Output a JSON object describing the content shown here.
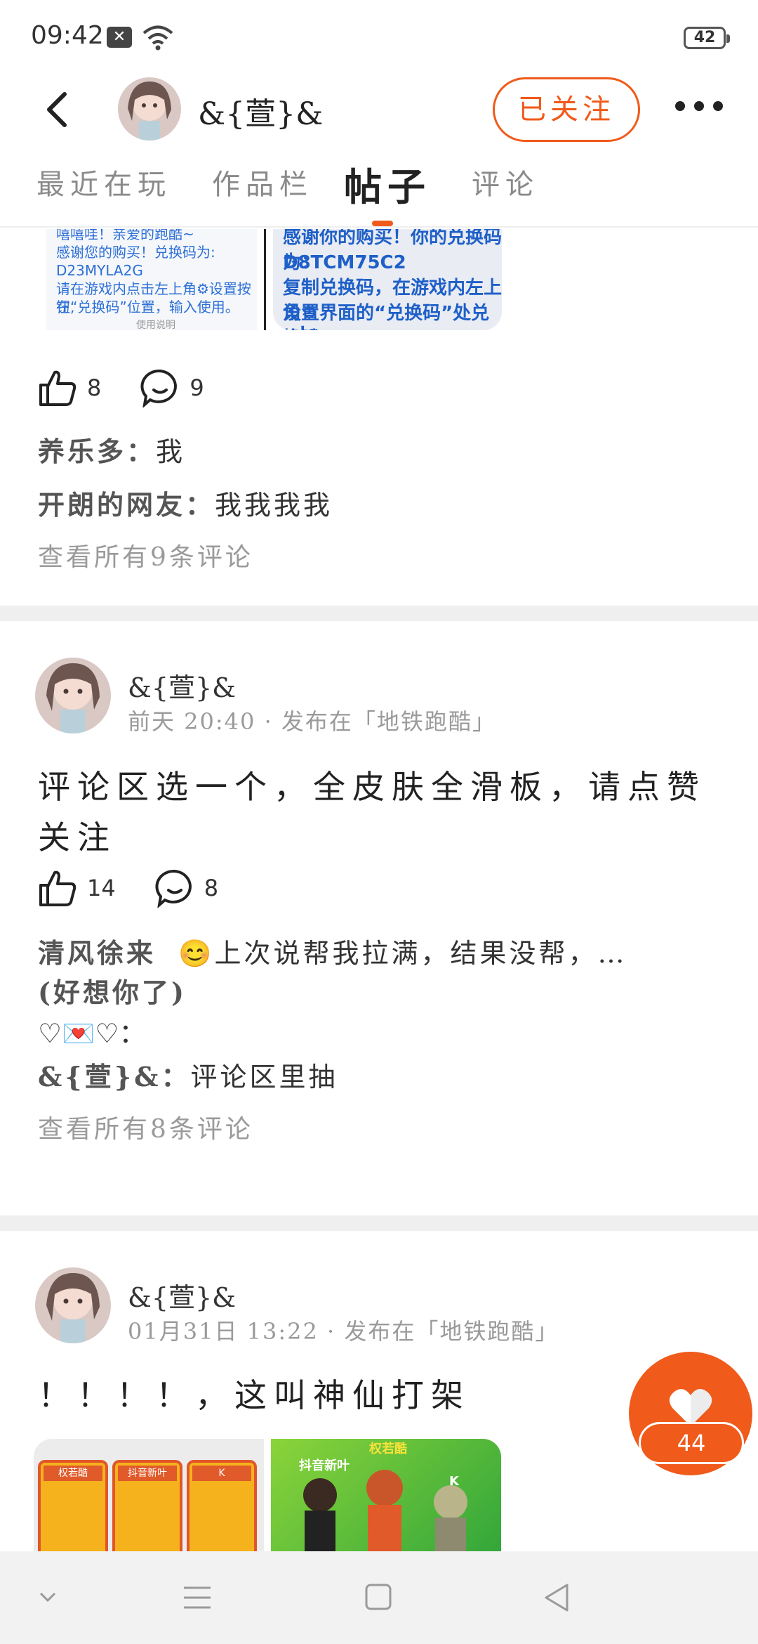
{
  "status_bar": {
    "time": "09:42",
    "battery": "42"
  },
  "header": {
    "username": "&{萱}&",
    "follow_label": "已关注"
  },
  "tabs": [
    {
      "label": "最近在玩"
    },
    {
      "label": "作品栏"
    },
    {
      "label": "帖子"
    },
    {
      "label": "评论"
    }
  ],
  "post1": {
    "image_a_lines": [
      "嘻嘻哇！亲爱的跑酷~",
      "感谢您的购买！兑换码为:",
      "D23MYLA2G",
      "请在游戏内点击左上角⚙设置按钮,",
      "在“兑换码”位置，输入使用。",
      "",
      "使用说明"
    ],
    "image_b_lines": [
      "感谢你的购买！你的兑换码为：",
      "D8TCM75C2",
      "复制兑换码，在游戏内左上角⚙",
      "设置界面的“兑换码”处兑换哦",
      "~！"
    ],
    "likes": "8",
    "comments": "9",
    "comment_list": [
      {
        "author": "养乐多：",
        "text": "我"
      },
      {
        "author": "开朗的网友：",
        "text": "我我我我"
      }
    ],
    "view_all": "查看所有9条评论"
  },
  "post2": {
    "author": "&{萱}&",
    "meta": "前天 20:40 · 发布在「地铁跑酷」",
    "body": "评论区选一个，全皮肤全滑板，请点赞关注",
    "likes": "14",
    "comments": "8",
    "comment1_author": "清风徐来",
    "comment1_emoji": "😊",
    "comment1_text": "上次说帮我拉满，结果没帮，…",
    "comment1_line2": "(好想你了)",
    "comment1_line3_emoji": "♡💌♡",
    "comment1_line3_tail": "：",
    "comment2_author": "&{萱}&：",
    "comment2_text": "评论区里抽",
    "view_all": "查看所有8条评论"
  },
  "post3": {
    "author": "&{萱}&",
    "meta": "01月31日 13:22 · 发布在「地铁跑酷」",
    "body": "！！！！，这叫神仙打架",
    "card_labels": [
      "权若酷",
      "抖音新叶",
      "K"
    ],
    "img_b_label_top": "权若酷",
    "img_b_label_left": "抖音新叶",
    "img_b_label_right": "K"
  },
  "float_like": {
    "count": "44"
  },
  "colors": {
    "accent": "#f05a1a"
  }
}
